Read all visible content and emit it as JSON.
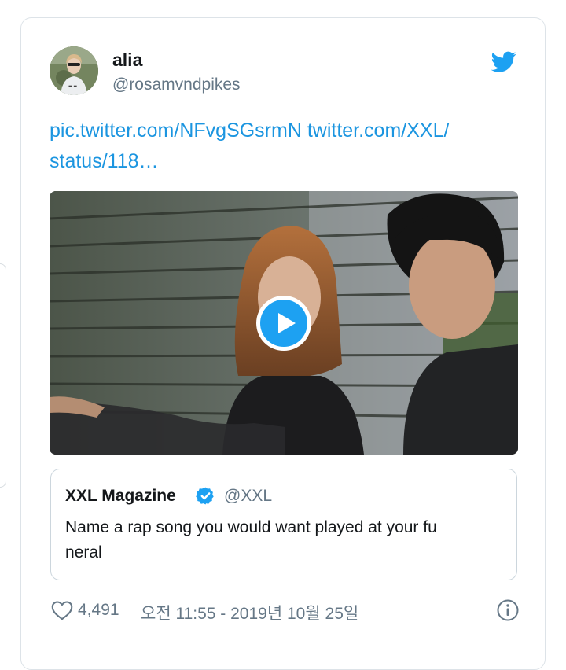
{
  "tweet": {
    "display_name": "alia",
    "handle": "@rosamvndpikes",
    "text_lines": [
      "pic.twitter.com/NFvgSGsrmN twitter.com/XXL/",
      "status/118…"
    ],
    "like_count": "4,491",
    "timestamp": "오전 11:55 - 2019년 10월 25일"
  },
  "quoted_tweet": {
    "display_name": "XXL Magazine",
    "handle": "@XXL",
    "text_lines": [
      "Name a rap song you would want played at your fu",
      "neral"
    ]
  },
  "icons": {
    "brand": "twitter-bird-icon",
    "verified": "verified-badge-icon",
    "play": "play-icon",
    "like": "heart-icon",
    "info": "info-icon"
  },
  "colors": {
    "twitter_blue": "#1da1f2",
    "link_blue": "#1b95e0",
    "secondary_text": "#657786",
    "primary_text": "#14171a",
    "border": "#dde3e8"
  }
}
